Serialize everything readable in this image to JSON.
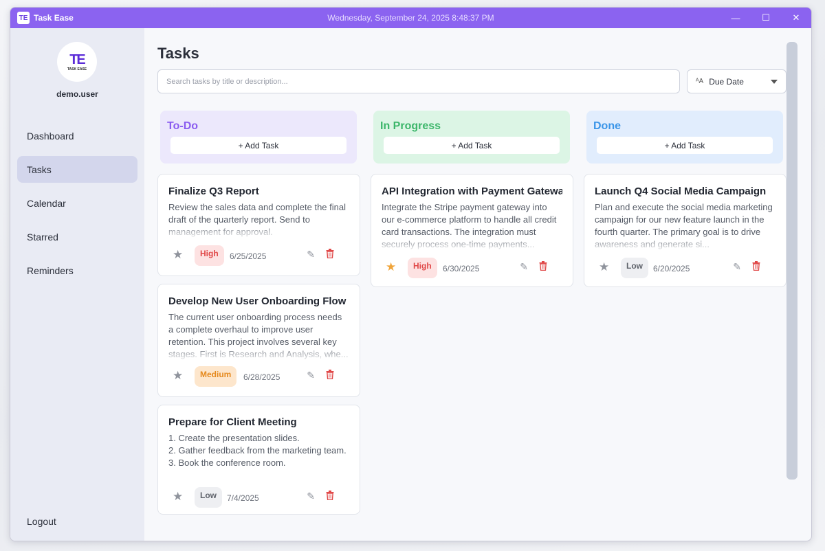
{
  "window": {
    "app_name": "Task Ease",
    "app_icon_glyph": "TE",
    "datetime": "Wednesday, September 24, 2025 8:48:37 PM",
    "controls": {
      "minimize": "—",
      "maximize": "☐",
      "close": "✕"
    }
  },
  "sidebar": {
    "logo_mark": "TE",
    "logo_text": "TASK EASE",
    "username": "demo.user",
    "items": [
      {
        "label": "Dashboard",
        "active": false
      },
      {
        "label": "Tasks",
        "active": true
      },
      {
        "label": "Calendar",
        "active": false
      },
      {
        "label": "Starred",
        "active": false
      },
      {
        "label": "Reminders",
        "active": false
      }
    ],
    "logout": "Logout"
  },
  "main": {
    "title": "Tasks",
    "search_placeholder": "Search tasks by title or description...",
    "sort": {
      "icon": "sort-alpha-icon",
      "icon_glyph": "ᴬA",
      "label": "Due Date"
    }
  },
  "colors": {
    "accent": "#8b63f0",
    "todo": "#8a5cf0",
    "todo_bg": "#ece8fc",
    "inprogress": "#3cb66a",
    "inprogress_bg": "#dcf5e5",
    "done": "#3a95e8",
    "done_bg": "#e1edfd"
  },
  "columns": [
    {
      "title": "To-Do",
      "add_label": "+ Add Task",
      "cards": [
        {
          "title": "Finalize Q3 Report",
          "description": " Review the sales data and complete the final draft of the quarterly report. Send to management for approval.",
          "starred": false,
          "priority": "High",
          "due": "6/25/2025"
        },
        {
          "title": "Develop New User Onboarding Flow",
          "description": "The current user onboarding process needs a complete overhaul to improve user retention. This project involves several key stages. First is Research and Analysis, whe...",
          "starred": false,
          "priority": "Medium",
          "due": "6/28/2025"
        },
        {
          "title": "Prepare for Client Meeting",
          "description": "1. Create the presentation slides.\n2. Gather feedback from the marketing team.\n3. Book the conference room.",
          "starred": false,
          "priority": "Low",
          "due": "7/4/2025"
        }
      ]
    },
    {
      "title": "In Progress",
      "add_label": "+ Add Task",
      "cards": [
        {
          "title": "API Integration with Payment Gatewa",
          "description": "Integrate the Stripe payment gateway into our e-commerce platform to handle all credit card transactions. The integration must securely process one-time payments...",
          "starred": true,
          "priority": "High",
          "due": "6/30/2025"
        }
      ]
    },
    {
      "title": "Done",
      "add_label": "+ Add Task",
      "cards": [
        {
          "title": "Launch Q4 Social Media Campaign",
          "description": "Plan and execute the social media marketing campaign for our new feature launch in the fourth quarter. The primary goal is to drive awareness and generate si...",
          "starred": false,
          "priority": "Low",
          "due": "6/20/2025"
        }
      ]
    }
  ]
}
